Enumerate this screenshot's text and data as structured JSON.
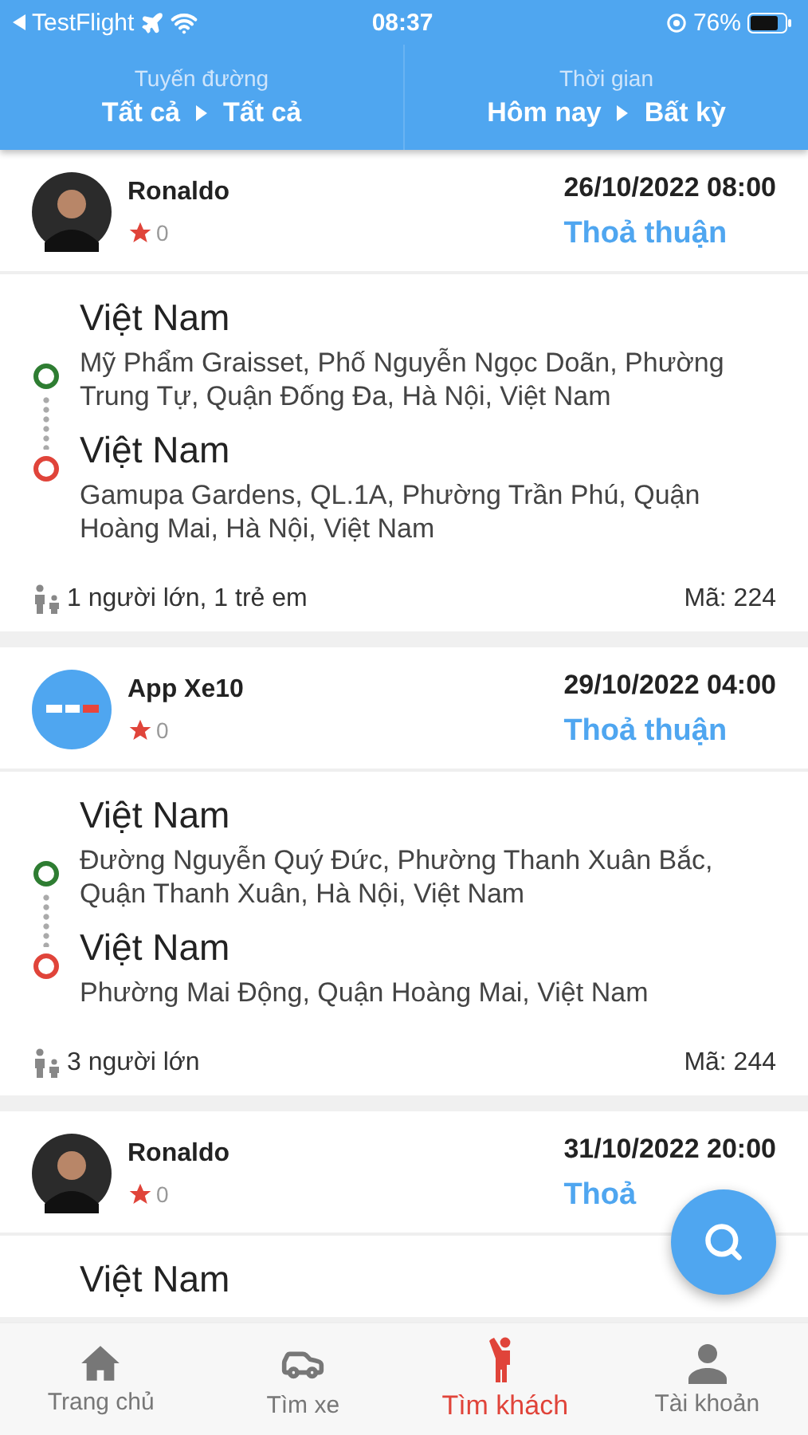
{
  "status_bar": {
    "back_app": "TestFlight",
    "time": "08:37",
    "battery": "76%"
  },
  "filters": [
    {
      "label": "Tuyến đường",
      "from": "Tất cả",
      "to": "Tất cả"
    },
    {
      "label": "Thời gian",
      "from": "Hôm nay",
      "to": "Bất kỳ"
    }
  ],
  "trips": [
    {
      "name": "Ronaldo",
      "kind": "person",
      "rating": "0",
      "datetime": "26/10/2022 08:00",
      "price": "Thoả thuận",
      "origin": {
        "title": "Việt Nam",
        "address": "Mỹ Phẩm Graisset, Phố Nguyễn Ngọc Doãn, Phường Trung Tự, Quận Đống Đa, Hà Nội, Việt Nam"
      },
      "destination": {
        "title": "Việt Nam",
        "address": "Gamupa Gardens, QL.1A, Phường Trần Phú, Quận Hoàng Mai, Hà Nội, Việt Nam"
      },
      "passengers": "1 người lớn, 1 trẻ em",
      "code": "Mã: 224"
    },
    {
      "name": "App Xe10",
      "kind": "logo",
      "rating": "0",
      "datetime": "29/10/2022 04:00",
      "price": "Thoả thuận",
      "origin": {
        "title": "Việt Nam",
        "address": "Đường Nguyễn Quý Đức, Phường Thanh Xuân Bắc, Quận Thanh Xuân, Hà Nội, Việt Nam"
      },
      "destination": {
        "title": "Việt Nam",
        "address": "Phường Mai Động, Quận Hoàng Mai, Việt Nam"
      },
      "passengers": "3 người lớn",
      "code": "Mã: 244"
    },
    {
      "name": "Ronaldo",
      "kind": "person",
      "rating": "0",
      "datetime": "31/10/2022 20:00",
      "price": "Thoả",
      "origin": {
        "title": "Việt Nam"
      }
    }
  ],
  "tab_bar": [
    {
      "label": "Trang chủ",
      "kind": "home",
      "selected": false
    },
    {
      "label": "Tìm xe",
      "kind": "car",
      "selected": false
    },
    {
      "label": "Tìm khách",
      "kind": "waving",
      "selected": true
    },
    {
      "label": "Tài khoản",
      "kind": "user",
      "selected": false
    }
  ]
}
